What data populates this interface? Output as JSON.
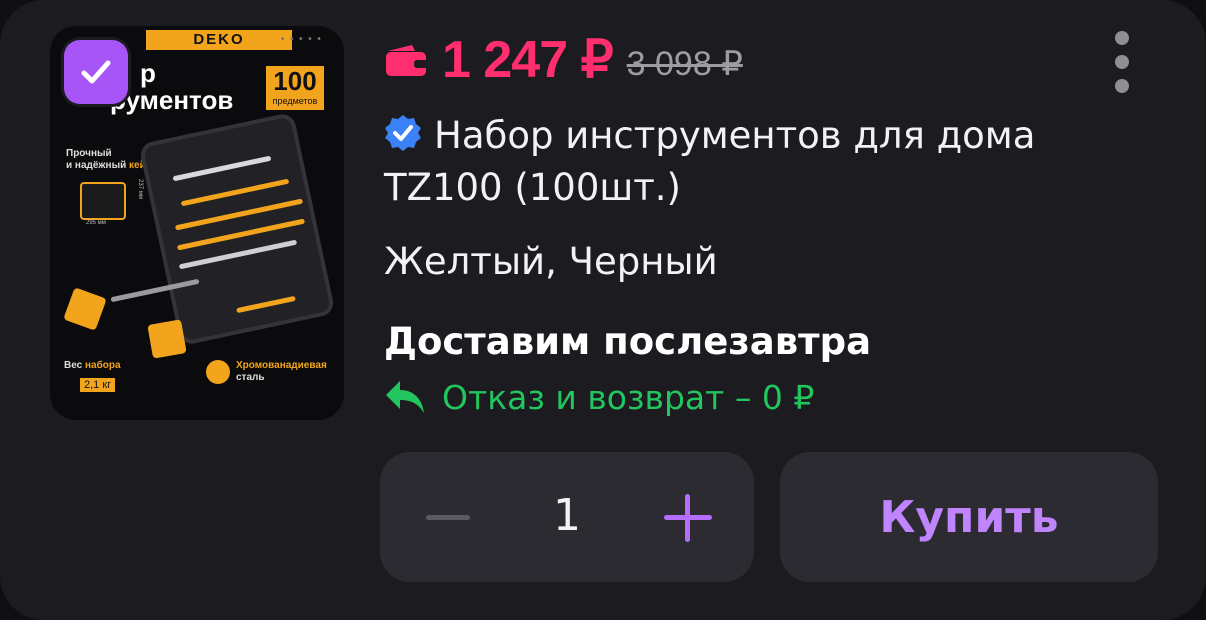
{
  "product": {
    "image": {
      "brand": "DEKO",
      "title_fragment_1": "р",
      "title_fragment_2": "рументов",
      "count": "100",
      "count_unit": "предметов",
      "case_label_1": "Прочный",
      "case_label_2": "и надёжный",
      "case_label_3": "кейс",
      "weight_label": "Вес",
      "weight_label_accent": "набора",
      "weight_value": "2,1 кг",
      "steel_label_1": "Хромованадиевая",
      "steel_label_2": "сталь",
      "dim_1": "295 мм",
      "dim_2": "237 мм"
    },
    "selected": true,
    "price": "1 247 ₽",
    "old_price": "3 098 ₽",
    "title": "Набор инструментов для дома TZ100 (100шт.)",
    "variant": "Желтый, Черный",
    "delivery": "Доставим послезавтра",
    "return_policy": "Отказ и возврат – 0 ₽"
  },
  "cart": {
    "quantity": "1",
    "buy_label": "Купить"
  },
  "colors": {
    "price": "#ff2e6e",
    "accent": "#a855f7",
    "return": "#22c55e",
    "verified": "#3b82f6",
    "background": "#1c1b20"
  },
  "icons": [
    "check-icon",
    "wallet-icon",
    "verified-icon",
    "return-arrow-icon",
    "more-vertical-icon",
    "minus-icon",
    "plus-icon"
  ]
}
